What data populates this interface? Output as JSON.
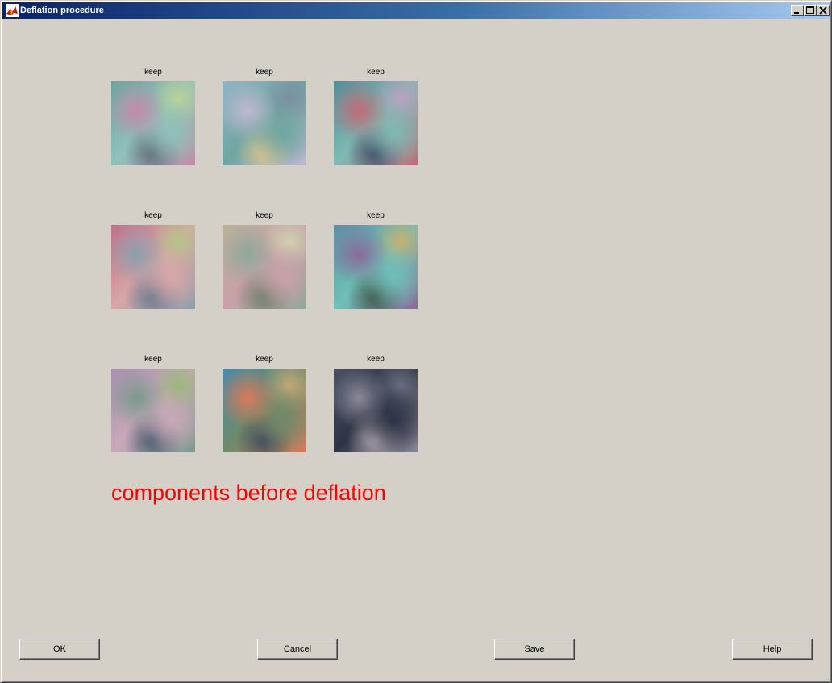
{
  "window": {
    "title": "Deflation procedure",
    "icon": "matlab-logo-icon",
    "controls": [
      "minimize-icon",
      "maximize-icon",
      "close-icon"
    ]
  },
  "components": [
    {
      "label": "keep",
      "palette": [
        "#6fa3a0",
        "#c48aa7",
        "#8fc2b9",
        "#5f6f7a",
        "#b9d19a"
      ]
    },
    {
      "label": "keep",
      "palette": [
        "#8fb4c7",
        "#c0b8d0",
        "#6fa6a0",
        "#d6c38e",
        "#7d8fa3"
      ]
    },
    {
      "label": "keep",
      "palette": [
        "#4f8f9a",
        "#c26a78",
        "#7fb9b2",
        "#3e4f6a",
        "#b9a0c0"
      ]
    },
    {
      "label": "keep",
      "palette": [
        "#c07088",
        "#8a9fae",
        "#d8a6a6",
        "#6a7a8e",
        "#b4c48a"
      ]
    },
    {
      "label": "keep",
      "palette": [
        "#b8b39a",
        "#8fa89a",
        "#c9a0a8",
        "#6f7f6a",
        "#d0d0b0"
      ]
    },
    {
      "label": "keep",
      "palette": [
        "#5a8ea6",
        "#8a6a9a",
        "#6fc0b8",
        "#3e5a4a",
        "#c4b070"
      ]
    },
    {
      "label": "keep",
      "palette": [
        "#a890b0",
        "#7a9a8e",
        "#c8a8b8",
        "#4a5a6e",
        "#9ab878"
      ]
    },
    {
      "label": "keep",
      "palette": [
        "#4a8aa8",
        "#d87a5a",
        "#6f8a6a",
        "#3e4a5a",
        "#c0a878"
      ]
    },
    {
      "label": "keep",
      "palette": [
        "#4a5060",
        "#8a8898",
        "#2e3444",
        "#a8a0a8",
        "#6a6e7e"
      ]
    }
  ],
  "caption": {
    "text": "components before deflation",
    "color": "#ff0000"
  },
  "buttons": {
    "ok": "OK",
    "cancel": "Cancel",
    "save": "Save",
    "help": "Help"
  }
}
